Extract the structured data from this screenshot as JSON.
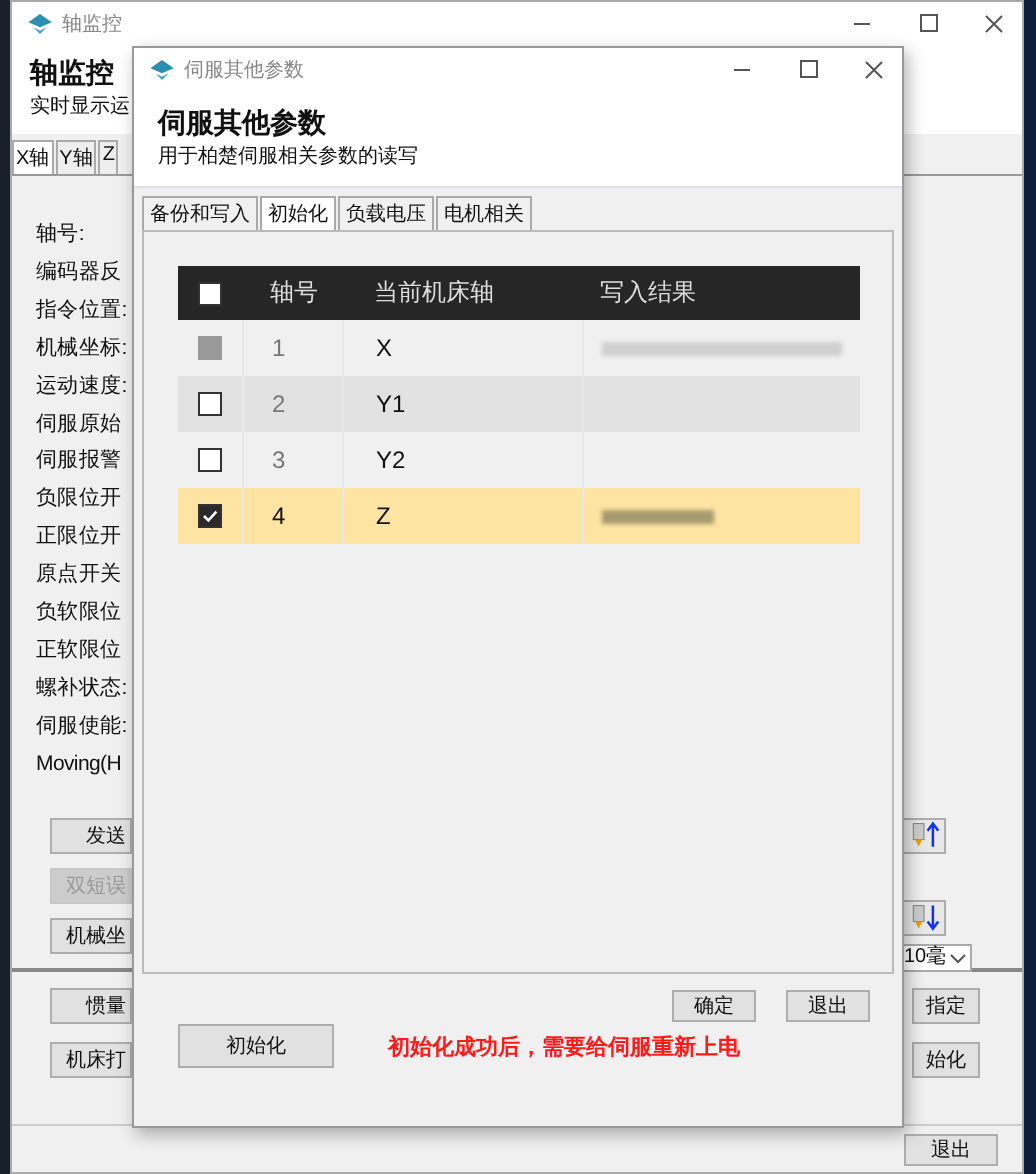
{
  "main_window": {
    "title": "轴监控",
    "heading": "轴监控",
    "subtitle": "实时显示运",
    "tabs": [
      {
        "label": "X轴",
        "selected": true
      },
      {
        "label": "Y轴",
        "selected": false
      },
      {
        "label": "Z",
        "selected": false
      }
    ],
    "fields": [
      "轴号:",
      "编码器反",
      "指令位置:",
      "机械坐标:",
      "运动速度:",
      "伺服原始",
      "伺服报警",
      "负限位开",
      "正限位开",
      "原点开关",
      "负软限位",
      "正软限位",
      "螺补状态:",
      "伺服使能:",
      "Moving(H"
    ],
    "left_buttons": [
      {
        "label": "发送",
        "disabled": false
      },
      {
        "label": "双短误",
        "disabled": true
      },
      {
        "label": "机械坐",
        "disabled": false
      }
    ],
    "jog_buttons": [
      {
        "kind": "up"
      },
      {
        "kind": "down"
      }
    ],
    "step_select": {
      "value": "10毫"
    },
    "lower_left_buttons": [
      "惯量",
      "机床打"
    ],
    "lower_right_buttons": [
      "指定",
      "始化"
    ],
    "exit_button": "退出"
  },
  "dialog": {
    "title": "伺服其他参数",
    "heading": "伺服其他参数",
    "subtitle": "用于柏楚伺服相关参数的读写",
    "tabs": [
      {
        "label": "备份和写入",
        "selected": false
      },
      {
        "label": "初始化",
        "selected": true
      },
      {
        "label": "负载电压",
        "selected": false
      },
      {
        "label": "电机相关",
        "selected": false
      }
    ],
    "table": {
      "header_checked": false,
      "columns": [
        "轴号",
        "当前机床轴",
        "写入结果"
      ],
      "rows": [
        {
          "axis_no": "1",
          "machine_axis": "X",
          "checked": false,
          "disabled": true,
          "selected": false,
          "result_blurred": true
        },
        {
          "axis_no": "2",
          "machine_axis": "Y1",
          "checked": false,
          "disabled": false,
          "selected": false,
          "result_blurred": false
        },
        {
          "axis_no": "3",
          "machine_axis": "Y2",
          "checked": false,
          "disabled": false,
          "selected": false,
          "result_blurred": false
        },
        {
          "axis_no": "4",
          "machine_axis": "Z",
          "checked": true,
          "disabled": false,
          "selected": true,
          "result_blurred": true
        }
      ]
    },
    "init_button": "初始化",
    "message": "初始化成功后，需要给伺服重新上电",
    "buttons": [
      "确定",
      "退出"
    ]
  }
}
